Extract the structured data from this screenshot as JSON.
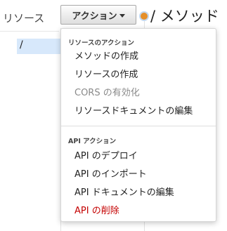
{
  "left_panel": {
    "title": "リソース",
    "tree_items": [
      "/"
    ]
  },
  "toolbar": {
    "actions_label": "アクション"
  },
  "page": {
    "title": "/ メソッド"
  },
  "actions_menu": {
    "resource_group_header": "リソースのアクション",
    "resource_items": [
      {
        "label": "メソッドの作成",
        "state": "enabled"
      },
      {
        "label": "リソースの作成",
        "state": "enabled"
      },
      {
        "label": "CORS の有効化",
        "state": "disabled"
      },
      {
        "label": "リソースドキュメントの編集",
        "state": "enabled"
      }
    ],
    "api_group_header": "API アクション",
    "api_items": [
      {
        "label": "API のデプロイ",
        "state": "enabled"
      },
      {
        "label": "API のインポート",
        "state": "enabled"
      },
      {
        "label": "API ドキュメントの編集",
        "state": "enabled"
      },
      {
        "label": "API の削除",
        "state": "danger"
      }
    ]
  },
  "colors": {
    "danger": "#c40000",
    "disabled": "#8a8a8a",
    "selection": "#d7e8fb",
    "status_dot": "#e58f2a"
  }
}
